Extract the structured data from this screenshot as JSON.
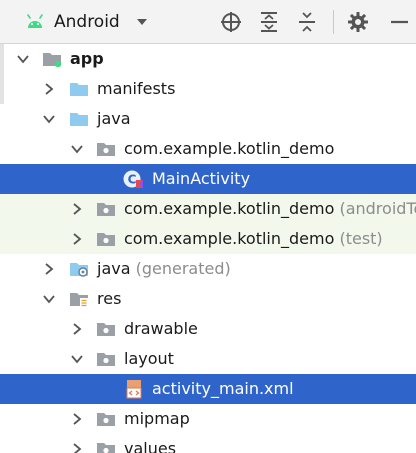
{
  "toolbar": {
    "view_label": "Android",
    "icons": [
      "target-icon",
      "expand-all-icon",
      "collapse-all-icon",
      "gear-icon",
      "minimize-icon"
    ]
  },
  "tree": {
    "rows": [
      {
        "label": "app",
        "suffix": ""
      },
      {
        "label": "manifests",
        "suffix": ""
      },
      {
        "label": "java",
        "suffix": ""
      },
      {
        "label": "com.example.kotlin_demo",
        "suffix": ""
      },
      {
        "label": "MainActivity",
        "suffix": ""
      },
      {
        "label": "com.example.kotlin_demo",
        "suffix": " (androidTest)"
      },
      {
        "label": "com.example.kotlin_demo",
        "suffix": " (test)"
      },
      {
        "label": "java",
        "suffix": " (generated)"
      },
      {
        "label": "res",
        "suffix": ""
      },
      {
        "label": "drawable",
        "suffix": ""
      },
      {
        "label": "layout",
        "suffix": ""
      },
      {
        "label": "activity_main.xml",
        "suffix": ""
      },
      {
        "label": "mipmap",
        "suffix": ""
      },
      {
        "label": "values",
        "suffix": ""
      }
    ]
  },
  "colors": {
    "selection": "#2f65ca",
    "test_highlight": "#f2f9ec",
    "android_green": "#3ddc84",
    "folder_blue": "#8fcbee",
    "package_gray": "#9aa0a6"
  }
}
